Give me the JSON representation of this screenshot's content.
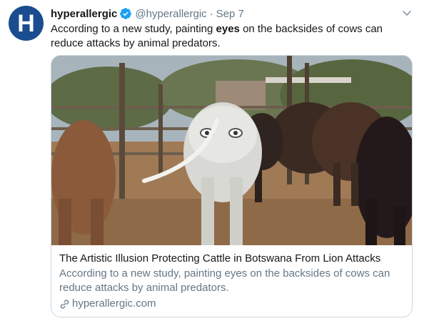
{
  "tweet": {
    "avatar_letter": "H",
    "author_name": "hyperallergic",
    "author_handle": "@hyperallergic",
    "separator": "·",
    "date": "Sep 7",
    "text_before": "According to a new study, painting ",
    "text_bold": "eyes",
    "text_after": " on the backsides of cows can reduce attacks by animal predators."
  },
  "card": {
    "title": "The Artistic Illusion Protecting Cattle in Botswana From Lion Attacks",
    "description": "According to a new study, painting eyes on the backsides of cows can reduce attacks by animal predators.",
    "domain": "hyperallergic.com",
    "image_icon": "cattle-photo"
  },
  "icons": {
    "verified": "verified-badge-icon",
    "caret": "chevron-down-icon",
    "link": "link-icon"
  },
  "colors": {
    "avatar_bg": "#1a4d8f",
    "verified_blue": "#1da1f2",
    "secondary_text": "#657786",
    "border": "#ccd6dd"
  }
}
